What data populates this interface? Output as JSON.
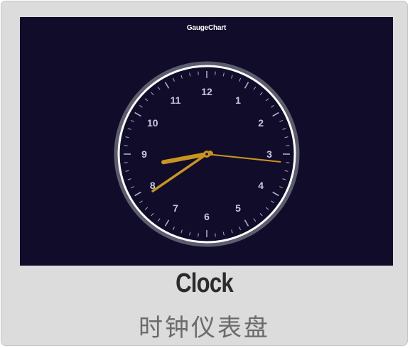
{
  "card": {
    "title": "Clock",
    "subtitle": "时钟仪表盘"
  },
  "chart": {
    "title": "GaugeChart"
  },
  "chart_data": {
    "type": "gauge",
    "title": "GaugeChart",
    "dial_labels": [
      "12",
      "1",
      "2",
      "3",
      "4",
      "5",
      "6",
      "7",
      "8",
      "9",
      "10",
      "11"
    ],
    "time": {
      "hour": 8,
      "minute": 39,
      "second": 16
    },
    "colors": {
      "background": "#100c2a",
      "hands": "#c9951f",
      "labels": "#c5c7e0",
      "rim": "#5b5d6e",
      "ring": "#ffffff"
    }
  }
}
